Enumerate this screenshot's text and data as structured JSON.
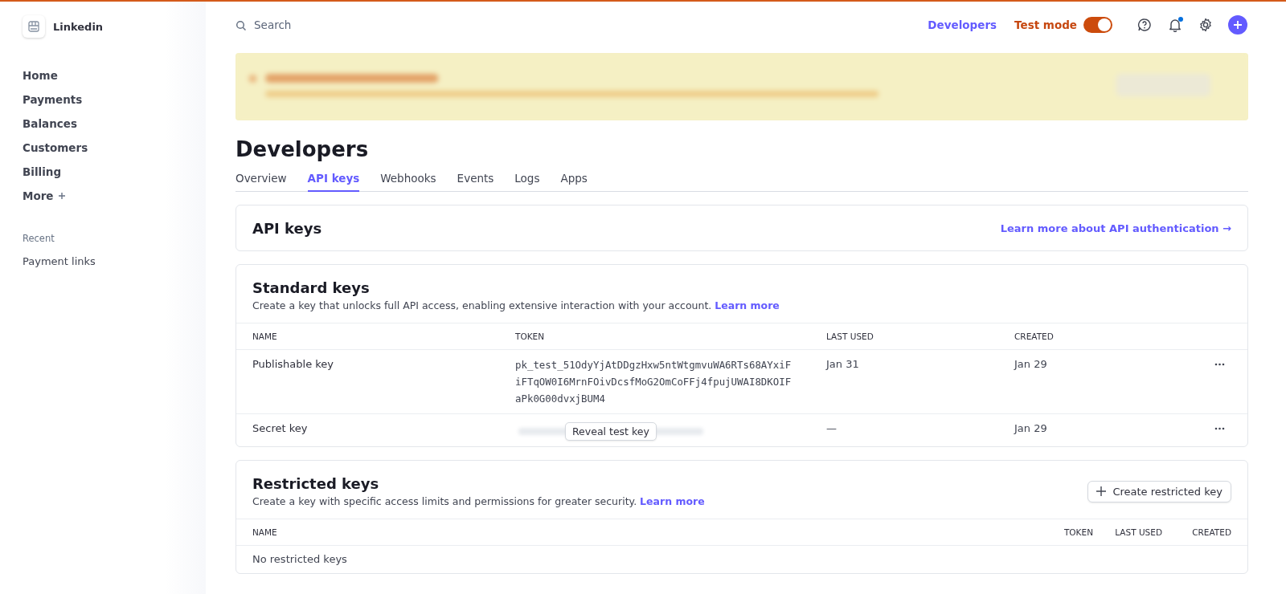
{
  "brand": {
    "name": "Linkedin"
  },
  "sidebar": {
    "items": [
      {
        "label": "Home",
        "kind": "link"
      },
      {
        "label": "Payments",
        "kind": "link"
      },
      {
        "label": "Balances",
        "kind": "link"
      },
      {
        "label": "Customers",
        "kind": "link"
      },
      {
        "label": "Billing",
        "kind": "link"
      },
      {
        "label": "More",
        "kind": "more"
      }
    ],
    "recent_heading": "Recent",
    "recent_items": [
      {
        "label": "Payment links"
      }
    ]
  },
  "topbar": {
    "search": {
      "placeholder": "Search"
    },
    "developers_link": "Developers",
    "test_mode": {
      "label": "Test mode",
      "on": true
    },
    "notifications_unread": true
  },
  "page": {
    "title": "Developers",
    "tabs": [
      {
        "label": "Overview",
        "selected": false
      },
      {
        "label": "API keys",
        "selected": true
      },
      {
        "label": "Webhooks",
        "selected": false
      },
      {
        "label": "Events",
        "selected": false
      },
      {
        "label": "Logs",
        "selected": false
      },
      {
        "label": "Apps",
        "selected": false
      }
    ]
  },
  "api_card": {
    "title": "API keys",
    "link": "Learn more about API authentication →"
  },
  "standard_keys": {
    "title": "Standard keys",
    "description": "Create a key that unlocks full API access, enabling extensive interaction with your account.",
    "learn_more": "Learn more",
    "columns": [
      "NAME",
      "TOKEN",
      "LAST USED",
      "CREATED"
    ],
    "rows": [
      {
        "name": "Publishable key",
        "token_hidden": false,
        "token": "pk_test_51OdyYjAtDDgzHxw5ntWtgmvuWA6RTs68AYxiFiFTqOW0I6MrnFOivDcsfMoG2OmCoFFj4fpujUWAI8DKOIFaPk0G00dvxjBUM4",
        "last_used": "Jan 31",
        "created": "Jan 29"
      },
      {
        "name": "Secret key",
        "token_hidden": true,
        "reveal_button": "Reveal test key",
        "last_used": "—",
        "created": "Jan 29"
      }
    ]
  },
  "restricted_keys": {
    "title": "Restricted keys",
    "description": "Create a key with specific access limits and permissions for greater security.",
    "learn_more": "Learn more",
    "create_button": "Create restricted key",
    "columns": [
      "NAME",
      "TOKEN",
      "LAST USED",
      "CREATED"
    ],
    "empty_text": "No restricted keys"
  }
}
